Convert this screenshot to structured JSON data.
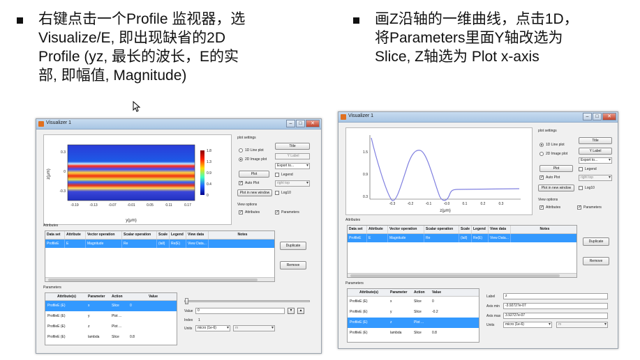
{
  "slide": {
    "left_bullet": [
      "右键点击一个Profile 监视器，选",
      "Visualize/E, 即出现缺省的2D",
      "Profile (yz, 最长的波长，E的实",
      "部, 即幅值, Magnitude)"
    ],
    "right_bullet": [
      "画Z沿轴的一维曲线，点击1D，",
      "将Parameters里面Y轴改选为",
      "Slice, Z轴选为 Plot x-axis"
    ]
  },
  "window_left": {
    "title": "Visualizer 1",
    "plot": {
      "ylabel": "z(μm)",
      "xlabel": "y(μm)",
      "yticks": [
        "0.3",
        "0",
        "-0.3"
      ],
      "xticks": [
        "-0.19",
        "-0.13",
        "-0.07",
        "-0.01",
        "0.05",
        "0.11",
        "0.17"
      ],
      "cbar_ticks": [
        "1.8",
        "1.3",
        "0.9",
        "0.4",
        "0"
      ]
    },
    "plot_settings": {
      "header": "plot settings",
      "radio_1d": "1D Line plot",
      "radio_2d": "2D Image plot",
      "title_btn": "Title",
      "ylabel_field": "Y Label",
      "export_combo": "Export to...",
      "plot_btn": "Plot",
      "legend_check": "Legend",
      "auto_plot": "Auto Plot",
      "position_combo": "right top",
      "new_window_btn": "Plot in new window",
      "log10": "Log10"
    },
    "view_options": {
      "header": "View options",
      "attributes": "Attributes",
      "parameters": "Parameters"
    },
    "attributes": {
      "header": "Attributes",
      "columns": [
        "Data set",
        "Attribute",
        "Vector operation",
        "Scalar operation",
        "Scale",
        "Legend",
        "View data",
        "Notes"
      ],
      "rows": [
        [
          "ProfileE",
          "E",
          "Magnitude",
          "Re",
          "(lall)",
          "Re(E)",
          "View Data...",
          ""
        ]
      ],
      "duplicate_btn": "Duplicate",
      "remove_btn": "Remove"
    },
    "parameters": {
      "header": "Parameters",
      "columns": [
        "Attribute(s)",
        "Parameter",
        "Action",
        "Value"
      ],
      "rows": [
        [
          "ProfileE (E)",
          "x",
          "Slice",
          "0"
        ],
        [
          "ProfileE (E)",
          "y",
          "Plot ...",
          ""
        ],
        [
          "ProfileE (E)",
          "z",
          "Plot ...",
          ""
        ],
        [
          "ProfileE (E)",
          "lambda",
          "Slice",
          "0.8"
        ]
      ],
      "value_label": "Value",
      "value": "0",
      "index_label": "Index",
      "index": "1",
      "units_label": "Units",
      "units_combo": "micro (1e-6)",
      "units_combo2": "m"
    }
  },
  "window_right": {
    "title": "Visualizer 1",
    "plot": {
      "xlabel": "z(μm)",
      "yticks": [
        "1.5",
        "0.9",
        "0.3"
      ],
      "xticks": [
        "-0.3",
        "-0.2",
        "-0.1",
        "-0.0",
        "0.1",
        "0.2",
        "0.3"
      ]
    },
    "plot_settings": {
      "header": "plot settings",
      "radio_1d": "1D Line plot",
      "radio_2d": "2D Image plot",
      "title_btn": "Title",
      "ylabel_btn": "Y Label",
      "export_combo": "Export to...",
      "plot_btn": "Plot",
      "legend_check": "Legend",
      "auto_plot": "Auto Plot",
      "position_combo": "right top",
      "new_window_btn": "Plot in new window",
      "log10": "Log10"
    },
    "view_options": {
      "header": "View options",
      "attributes": "Attributes",
      "parameters": "Parameters"
    },
    "attributes": {
      "header": "Attributes",
      "columns": [
        "Data set",
        "Attribute",
        "Vector operation",
        "Scalar operation",
        "Scale",
        "Legend",
        "View data",
        "Notes"
      ],
      "rows": [
        [
          "ProfileE",
          "E",
          "Magnitude",
          "Re",
          "(lall)",
          "Re(E)",
          "View Data...",
          ""
        ]
      ],
      "duplicate_btn": "Duplicate",
      "remove_btn": "Remove"
    },
    "parameters": {
      "header": "Parameters",
      "columns": [
        "Attribute(s)",
        "Parameter",
        "Action",
        "Value"
      ],
      "rows": [
        [
          "ProfileE (E)",
          "x",
          "Slice",
          "0"
        ],
        [
          "ProfileE (E)",
          "y",
          "Slice",
          "-0.2"
        ],
        [
          "ProfileE (E)",
          "z",
          "Plot ...",
          ""
        ],
        [
          "ProfileE (E)",
          "lambda",
          "Slice",
          "0.8"
        ]
      ],
      "label_label": "Label",
      "label_value": "z",
      "axis_min_label": "Axis min",
      "axis_min": "-3.92727e-07",
      "axis_max_label": "Axis max",
      "axis_max": "3.92727e-07",
      "units_label": "Units",
      "units_combo": "micro (1e-6)",
      "units_combo2": "m"
    }
  },
  "colors": {
    "selection": "#3399ff",
    "curve": "#8080e0"
  }
}
